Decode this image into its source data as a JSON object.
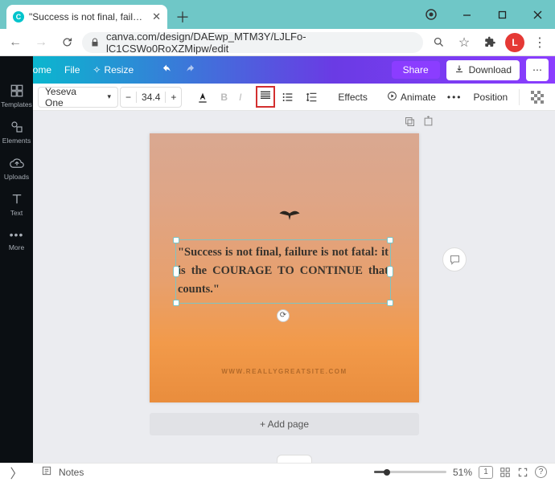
{
  "browser": {
    "tab_title": "\"Success is not final, failure is not",
    "url": "canva.com/design/DAEwp_MTM3Y/LJLFo-lC1CSWo0RoXZMipw/edit",
    "avatar_initial": "L"
  },
  "topbar": {
    "home": "Home",
    "file": "File",
    "resize": "Resize",
    "share": "Share",
    "download": "Download"
  },
  "toolbar": {
    "font_name": "Yeseva One",
    "font_size": "34.4",
    "effects": "Effects",
    "animate": "Animate",
    "position": "Position"
  },
  "siderail": {
    "templates": "Templates",
    "elements": "Elements",
    "uploads": "Uploads",
    "text": "Text",
    "more": "More"
  },
  "canvas": {
    "quote": "\"Success is not final, failure is not fatal: it is the COURAGE TO CONTINUE that counts.\"",
    "site_credit": "WWW.REALLYGREATSITE.COM",
    "add_page": "+ Add page"
  },
  "footer": {
    "notes": "Notes",
    "zoom": "51%",
    "page_indicator": "1"
  }
}
